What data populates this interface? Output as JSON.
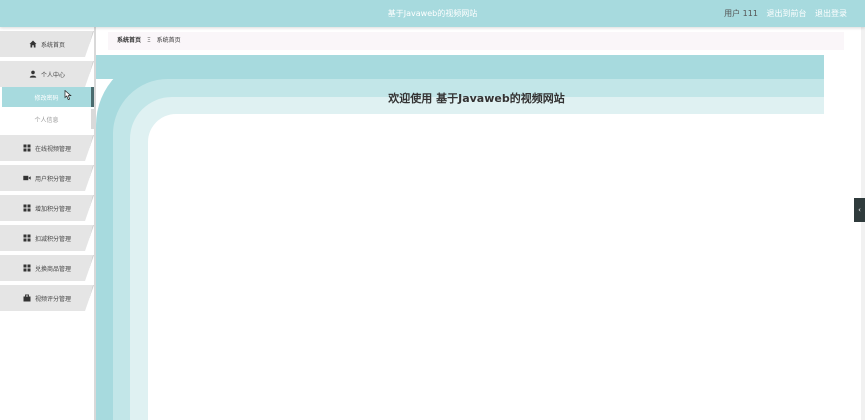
{
  "topbar": {
    "title": "基于Javaweb的视频网站",
    "user_label": "用户 111",
    "back_front": "退出到前台",
    "logout": "退出登录"
  },
  "sidebar": {
    "items": [
      {
        "label": "系统首页",
        "icon": "home-icon"
      },
      {
        "label": "个人中心",
        "icon": "user-icon"
      },
      {
        "label": "在线视频管理",
        "icon": "grid-icon"
      },
      {
        "label": "用户积分管理",
        "icon": "video-icon"
      },
      {
        "label": "增加积分管理",
        "icon": "grid-icon"
      },
      {
        "label": "扣减积分管理",
        "icon": "grid-icon"
      },
      {
        "label": "兑换商品管理",
        "icon": "grid-icon"
      },
      {
        "label": "视频评分管理",
        "icon": "bag-icon"
      }
    ],
    "sub_items": [
      {
        "label": "修改密码",
        "active": true
      },
      {
        "label": "个人信息",
        "active": false
      }
    ]
  },
  "breadcrumb": {
    "home": "系统首页",
    "separator": "Ξ",
    "current": "系统首页"
  },
  "main": {
    "welcome": "欢迎使用 基于Javaweb的视频网站"
  },
  "colors": {
    "accent": "#a7dade",
    "accent_light": "#c2e6e8",
    "accent_lighter": "#dff1f2"
  }
}
